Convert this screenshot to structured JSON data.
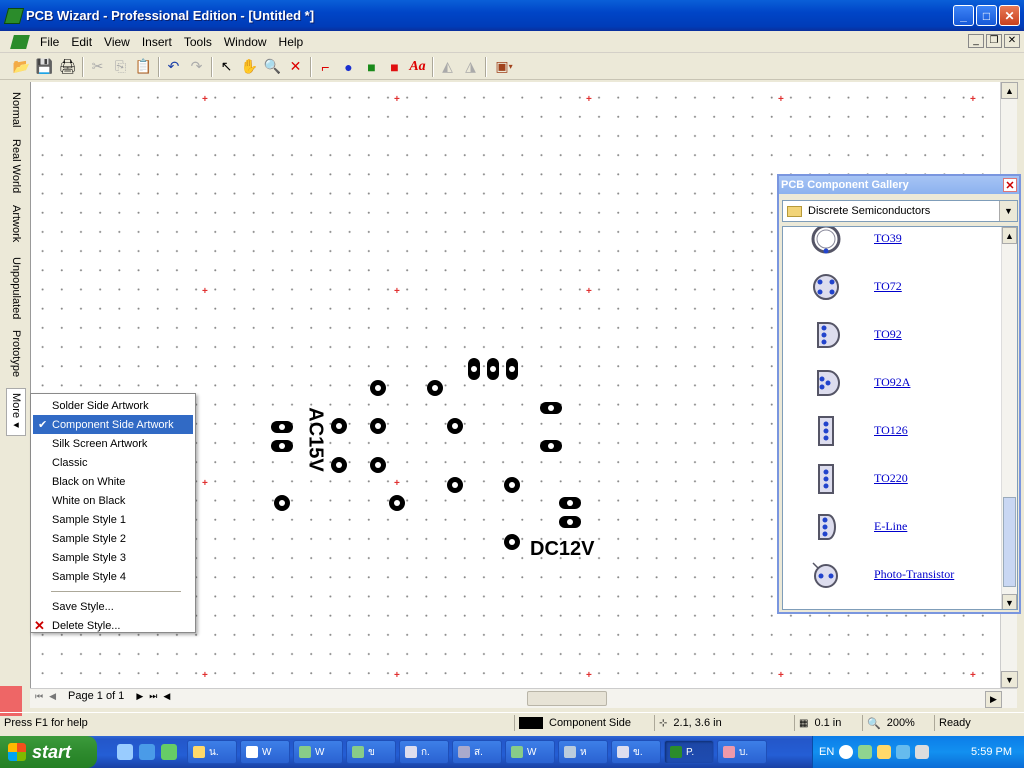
{
  "window": {
    "title": "PCB Wizard - Professional Edition - [Untitled *]",
    "controls": [
      "_",
      "□",
      "✕"
    ]
  },
  "menubar": {
    "items": [
      "File",
      "Edit",
      "View",
      "Insert",
      "Tools",
      "Window",
      "Help"
    ],
    "mdi_controls": [
      "_",
      "❐",
      "✕"
    ]
  },
  "toolbar": {
    "buttons": [
      {
        "name": "open-icon",
        "glyph": "📂"
      },
      {
        "name": "save-icon",
        "glyph": "💾"
      },
      {
        "name": "print-icon",
        "glyph": "🖨"
      },
      {
        "name": "cut-icon",
        "glyph": "✂"
      },
      {
        "name": "copy-icon",
        "glyph": "⎘"
      },
      {
        "name": "paste-icon",
        "glyph": "📋"
      },
      {
        "name": "undo-icon",
        "glyph": "↶"
      },
      {
        "name": "redo-icon",
        "glyph": "↷"
      },
      {
        "name": "select-icon",
        "glyph": "↖"
      },
      {
        "name": "pan-hand-icon",
        "glyph": "✋"
      },
      {
        "name": "zoom-icon",
        "glyph": "🔍"
      },
      {
        "name": "delete-icon",
        "glyph": "✕"
      },
      {
        "name": "track-icon",
        "glyph": "⌐"
      },
      {
        "name": "pad-icon",
        "glyph": "●"
      },
      {
        "name": "copper-area-icon",
        "glyph": "■"
      },
      {
        "name": "component-area-icon",
        "glyph": "■"
      },
      {
        "name": "text-icon",
        "glyph": "Aa"
      },
      {
        "name": "flip-icon",
        "glyph": "◭"
      },
      {
        "name": "mirror-icon",
        "glyph": "◮"
      },
      {
        "name": "gallery-icon",
        "glyph": "▣"
      }
    ]
  },
  "view_tabs": [
    "Normal",
    "Real World",
    "Artwork",
    "Unpopulated",
    "Prototype",
    "More"
  ],
  "board": {
    "labels": {
      "ac": "AC15V",
      "dc": "DC12V"
    }
  },
  "context_menu": {
    "items": [
      {
        "label": "Solder Side Artwork",
        "checked": false
      },
      {
        "label": "Component Side Artwork",
        "checked": true,
        "selected": true
      },
      {
        "label": "Silk Screen Artwork",
        "checked": false
      },
      {
        "label": "Classic",
        "checked": false
      },
      {
        "label": "Black on White",
        "checked": false
      },
      {
        "label": "White on Black",
        "checked": false
      },
      {
        "label": "Sample Style 1",
        "checked": false
      },
      {
        "label": "Sample Style 2",
        "checked": false
      },
      {
        "label": "Sample Style 3",
        "checked": false
      },
      {
        "label": "Sample Style 4",
        "checked": false
      }
    ],
    "actions": [
      {
        "label": "Save Style...",
        "icon": ""
      },
      {
        "label": "Delete Style...",
        "icon": "delete-x-icon"
      }
    ]
  },
  "gallery": {
    "title": "PCB Component Gallery",
    "category": "Discrete Semiconductors",
    "items": [
      "TO39",
      "TO72",
      "TO92",
      "TO92A",
      "TO126",
      "TO220",
      "E-Line",
      "Photo-Transistor"
    ]
  },
  "pager": {
    "label": "Page 1 of 1"
  },
  "statusbar": {
    "help": "Press F1 for help",
    "layer": "Component Side",
    "coords": "2.1, 3.6 in",
    "grid": "0.1 in",
    "zoom": "200%",
    "state": "Ready"
  },
  "taskbar": {
    "start_label": "start",
    "tasks": [
      "น.",
      "W",
      "W",
      "ข",
      "ก.",
      "ส.",
      "W",
      "ห",
      "ข.",
      "P.",
      "บ."
    ],
    "active_task_index": 9,
    "language": "EN",
    "clock": "5:59 PM"
  }
}
